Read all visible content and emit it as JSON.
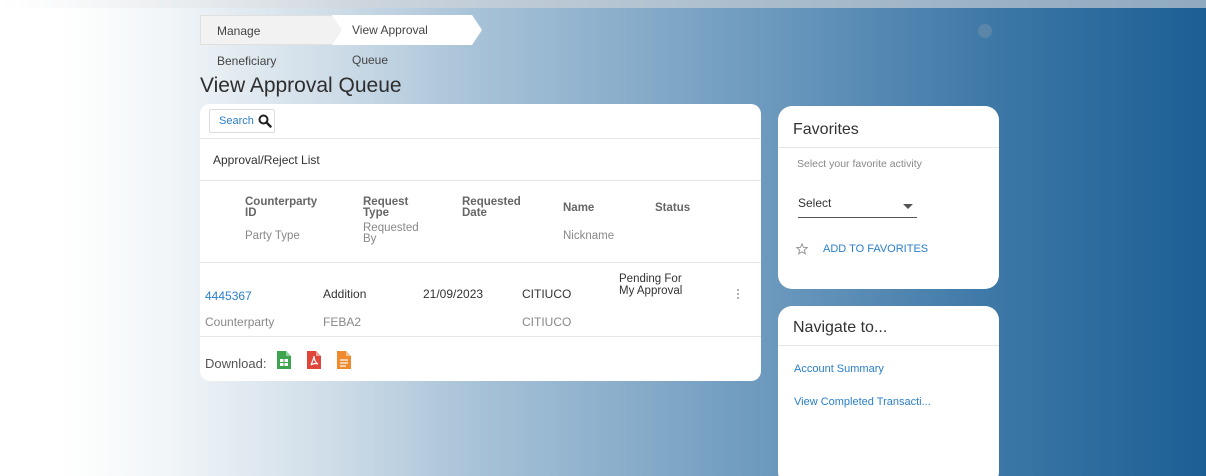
{
  "breadcrumb": {
    "items": [
      "Manage Beneficiary",
      "View Approval Queue"
    ]
  },
  "page": {
    "title": "View Approval Queue"
  },
  "search": {
    "label": "Search"
  },
  "list": {
    "title": "Approval/Reject List",
    "headers": {
      "counterparty_id": "Counterparty ID",
      "party_type": "Party Type",
      "request_type": "Request Type",
      "requested_by": "Requested By",
      "requested_date": "Requested Date",
      "name": "Name",
      "nickname": "Nickname",
      "status": "Status"
    },
    "rows": [
      {
        "counterparty_id": "4445367",
        "party_type": "Counterparty",
        "request_type": "Addition",
        "requested_by": "FEBA2",
        "requested_date": "21/09/2023",
        "name": "CITIUCO",
        "nickname": "CITIUCO",
        "status": "Pending For My Approval"
      }
    ],
    "download_label": "Download:",
    "download_icons": [
      "excel-icon",
      "pdf-icon",
      "csv-icon"
    ]
  },
  "favorites": {
    "title": "Favorites",
    "subtitle": "Select your favorite activity",
    "select_value": "Select",
    "add_label": "ADD TO FAVORITES"
  },
  "navigate": {
    "title": "Navigate to...",
    "links": [
      "Account Summary",
      "View Completed Transacti..."
    ]
  },
  "colors": {
    "link": "#2a7fc9",
    "excel": "#3da44d",
    "pdf": "#e0453a",
    "csv": "#f08a2e"
  }
}
